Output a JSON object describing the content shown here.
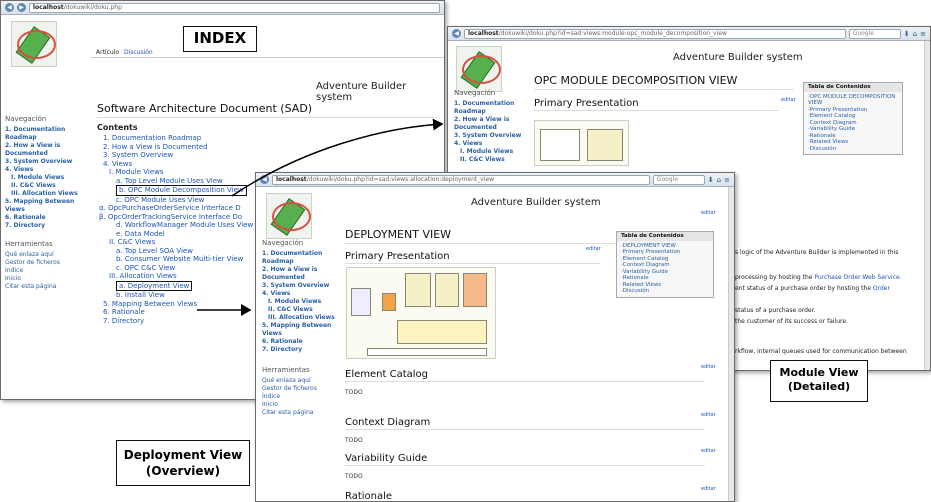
{
  "index_window": {
    "url_host": "localhost",
    "url_path": "/dokuwiki/doku.php",
    "search_placeholder": "Google",
    "tabs": [
      "Artículo",
      "Discusión"
    ],
    "site_title": "Adventure Builder system",
    "heading": "Software Architecture Document (SAD)",
    "contents_label": "Contents",
    "nav_heading": "Navegación",
    "nav_items": [
      "1. Documentation Roadmap",
      "2. How a View is Documented",
      "3. System Overview",
      "4. Views",
      "I. Module Views",
      "II. C&C Views",
      "III. Allocation Views",
      "5. Mapping Between Views",
      "6. Rationale",
      "7. Directory"
    ],
    "tools_heading": "Herramientas",
    "tools_items": [
      "Qué enlaza aquí",
      "Gestor de ficheros",
      "Índice",
      "Inicio",
      "Citar esta página"
    ],
    "toc": [
      {
        "text": "1. Documentation Roadmap",
        "level": 1
      },
      {
        "text": "2. How a View is Documented",
        "level": 1
      },
      {
        "text": "3. System Overview",
        "level": 1
      },
      {
        "text": "4. Views",
        "level": 1
      },
      {
        "text": "I. Module Views",
        "level": 2
      },
      {
        "text": "a. Top Level Module Uses View",
        "level": 3
      },
      {
        "text": "b. OPC Module Decomposition View",
        "level": 3,
        "highlight": true
      },
      {
        "text": "c. OPC Module Uses View",
        "level": 3
      },
      {
        "text": "α. OpcPurchaseOrderService Interface D",
        "level": 4
      },
      {
        "text": "β. OpcOrderTrackingService Interface Do",
        "level": 4
      },
      {
        "text": "d. WorkflowManager Module Uses View",
        "level": 3
      },
      {
        "text": "e. Data Model",
        "level": 3
      },
      {
        "text": "II. C&C Views",
        "level": 2
      },
      {
        "text": "a. Top Level SOA View",
        "level": 3
      },
      {
        "text": "b. Consumer Website Multi-tier View",
        "level": 3
      },
      {
        "text": "c. OPC C&C View",
        "level": 3
      },
      {
        "text": "III. Allocation Views",
        "level": 2
      },
      {
        "text": "a. Deployment View",
        "level": 3,
        "highlight": true
      },
      {
        "text": "b. Install View",
        "level": 3
      },
      {
        "text": "5. Mapping Between Views",
        "level": 1
      },
      {
        "text": "6. Rationale",
        "level": 1
      },
      {
        "text": "7. Directory",
        "level": 1
      }
    ]
  },
  "module_window": {
    "url_host": "localhost",
    "url_path": "/dokuwiki/doku.php?id=sad:views:module:opc_module_decomposition_view",
    "search_placeholder": "Google",
    "site_title": "Adventure Builder system",
    "heading": "OPC MODULE DECOMPOSITION VIEW",
    "section": "Primary Presentation",
    "edit_label": "editar",
    "nav_heading": "Navegación",
    "nav_items": [
      "1. Documentation Roadmap",
      "2. How a View is Documented",
      "3. System Overview",
      "4. Views",
      "I. Module Views",
      "II. C&C Views"
    ],
    "toc_title": "Tabla de Contenidos",
    "toc_items": [
      "OPC MODULE DECOMPOSITION VIEW",
      "Primary Presentation",
      "Element Catalog",
      "Context Diagram",
      "Variability Guide",
      "Rationale",
      "Related Views",
      "Discusión"
    ],
    "body_lines": [
      {
        "text": "s logic of the Adventure Builder is implemented in this",
        "link": ""
      },
      {
        "text": "processing by hosting the ",
        "link": "Purchase Order Web Service."
      },
      {
        "text": "ent status of a purchase order by hosting the ",
        "link": "Order"
      },
      {
        "text": "status of a purchase order.",
        "link": ""
      },
      {
        "text": "the customer of its success or failure.",
        "link": ""
      },
      {
        "text": "rkflow, internal queues used for communication between",
        "link": ""
      }
    ]
  },
  "deploy_window": {
    "url_host": "localhost",
    "url_path": "/dokuwiki/doku.php?id=sad:views:allocation:deployment_view",
    "search_placeholder": "Google",
    "site_title": "Adventure Builder system",
    "heading": "DEPLOYMENT VIEW",
    "edit_label": "editar",
    "nav_heading": "Navegación",
    "nav_items": [
      "1. Documentation Roadmap",
      "2. How a View is Documented",
      "3. System Overview",
      "4. Views",
      "I. Module Views",
      "II. C&C Views",
      "III. Allocation Views",
      "5. Mapping Between Views",
      "6. Rationale",
      "7. Directory"
    ],
    "tools_heading": "Herramientas",
    "tools_items": [
      "Qué enlaza aquí",
      "Gestor de ficheros",
      "Índice",
      "Inicio",
      "Citar esta página"
    ],
    "toc_title": "Tabla de Contenidos",
    "toc_items": [
      "DEPLOYMENT VIEW",
      "Primary Presentation",
      "Element Catalog",
      "Context Diagram",
      "Variability Guide",
      "Rationale",
      "Related Views",
      "Discusión"
    ],
    "sections": [
      "Primary Presentation",
      "Element Catalog",
      "Context Diagram",
      "Variability Guide",
      "Rationale"
    ],
    "todo_text": "TODO"
  },
  "callouts": {
    "index": "INDEX",
    "module": "Module View\n(Detailed)",
    "deploy": "Deployment View\n(Overview)"
  }
}
